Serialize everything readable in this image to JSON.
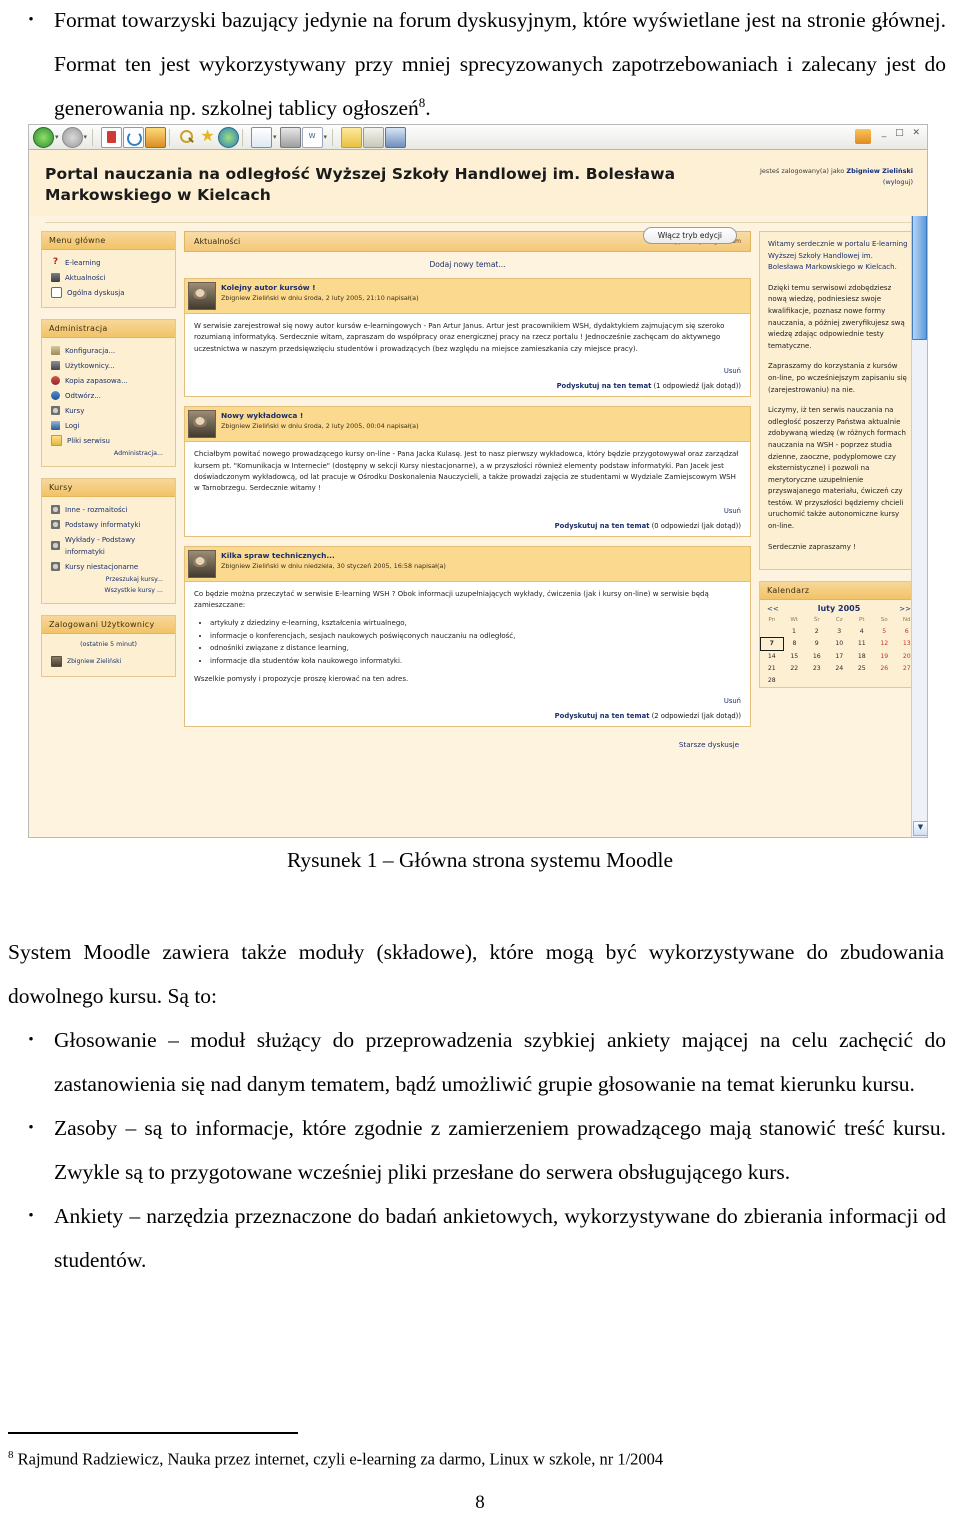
{
  "document": {
    "intro_bullets": [
      "Format towarzyski bazujący jedynie na forum dyskusyjnym, które wyświetlane jest na stronie głównej. Format ten jest wykorzystywany przy mniej sprecyzowanych zapotrzebowaniach i zalecany jest do generowania np. szkolnej tablicy ogłoszeń"
    ],
    "intro_footnote_marker": "8",
    "intro_trailing": ".",
    "figure_caption": "Rysunek 1 – Główna strona systemu Moodle",
    "after_paragraph": "System Moodle zawiera także moduły (składowe), które mogą być wykorzystywane do zbudowania dowolnego kursu. Są to:",
    "after_bullets": [
      "Głosowanie – moduł służący do przeprowadzenia szybkiej ankiety mającej na celu zachęcić do zastanowienia się nad danym tematem, bądź umożliwić grupie głosowanie na temat kierunku kursu.",
      "Zasoby – są to informacje, które zgodnie z zamierzeniem prowadzącego mają stanowić treść kursu. Zwykle są to przygotowane wcześniej pliki przesłane do serwera obsługującego kurs.",
      "Ankiety – narzędzia przeznaczone do badań ankietowych, wykorzystywane do zbierania informacji od studentów."
    ],
    "footnote_marker": "8",
    "footnote_text": "Rajmund Radziewicz, Nauka przez internet, czyli e-learning za darmo, Linux w szkole, nr 1/2004",
    "page_number": "8"
  },
  "screenshot": {
    "browser": {
      "window_buttons": "_ □ ✕",
      "toolbar_icons": [
        "back-arrow-icon",
        "forward-arrow-icon",
        "stop-icon",
        "refresh-icon",
        "home-icon",
        "search-icon",
        "favorites-star-icon",
        "history-icon",
        "mail-icon",
        "print-icon",
        "edit-word-icon",
        "notes-icon",
        "messenger-icon",
        "research-icon"
      ]
    },
    "header": {
      "site_title": "Portal nauczania na odległość Wyższej Szkoły Handlowej im. Bolesława Markowskiego w Kielcach",
      "login_prefix": "Jesteś zalogowany(a) jako ",
      "login_user": "Zbigniew Zieliński",
      "logout_label": "(wyloguj)"
    },
    "left_blocks": [
      {
        "title": "Menu główne",
        "items": [
          {
            "label": "E-learning",
            "icon": "question-mark-icon"
          },
          {
            "label": "Aktualności",
            "icon": "news-forum-icon"
          },
          {
            "label": "Ogólna dyskusja",
            "icon": "chat-bubble-icon"
          }
        ],
        "links": []
      },
      {
        "title": "Administracja",
        "items": [
          {
            "label": "Konfiguracja...",
            "icon": "config-tool-icon"
          },
          {
            "label": "Użytkownicy...",
            "icon": "users-icon"
          },
          {
            "label": "Kopia zapasowa...",
            "icon": "backup-icon"
          },
          {
            "label": "Odtwórz...",
            "icon": "restore-icon"
          },
          {
            "label": "Kursy",
            "icon": "courses-icon"
          },
          {
            "label": "Logi",
            "icon": "logs-icon"
          },
          {
            "label": "Pliki serwisu",
            "icon": "folder-icon"
          }
        ],
        "links": [
          "Administracja..."
        ]
      },
      {
        "title": "Kursy",
        "items": [
          {
            "label": "Inne - rozmaitości",
            "icon": "course-icon"
          },
          {
            "label": "Podstawy informatyki",
            "icon": "course-icon"
          },
          {
            "label": "Wykłady - Podstawy informatyki",
            "icon": "course-icon"
          },
          {
            "label": "Kursy niestacjonarne",
            "icon": "course-icon"
          }
        ],
        "links": [
          "Przeszukaj kursy...",
          "Wszystkie kursy ..."
        ]
      },
      {
        "title": "Zalogowani Użytkownicy",
        "subtitle": "(ostatnie 5 minut)",
        "items": [
          {
            "label": "Zbigniew Zieliński",
            "icon": "avatar-icon"
          }
        ],
        "links": []
      }
    ],
    "forum": {
      "section_title": "Aktualności",
      "unsubscribe_label": "Wypisz się z tego forum",
      "edit_mode_button": "Włącz tryb edycji",
      "add_topic_label": "Dodaj nowy temat...",
      "older_discussions_label": "Starsze dyskusje",
      "delete_label": "Usuń",
      "discuss_label": "Podyskutuj na ten temat",
      "posts": [
        {
          "title": "Kolejny autor kursów !",
          "meta": "Zbigniew Zieliński w dniu środa, 2 luty 2005, 21:10 napisał(a)",
          "paragraphs": [
            "W serwisie zarejestrował się nowy autor kursów e-learningowych - Pan Artur Janus. Artur jest pracownikiem WSH, dydaktykiem zajmującym się szeroko rozumianą informatyką. Serdecznie witam, zapraszam do współpracy oraz energicznej pracy na rzecz portalu ! Jednocześnie zachęcam do aktywnego uczestnictwa w naszym przedsięwzięciu studentów i prowadzących (bez względu na miejsce zamieszkania czy miejsce pracy)."
          ],
          "bullets": [],
          "tail": "",
          "replies": "(1 odpowiedź (jak dotąd))"
        },
        {
          "title": "Nowy wykładowca !",
          "meta": "Zbigniew Zieliński w dniu środa, 2 luty 2005, 00:04 napisał(a)",
          "paragraphs": [
            "Chciałbym powitać nowego prowadzącego kursy on-line - Pana Jacka Kulasę. Jest to nasz pierwszy wykładowca, który będzie przygotowywał oraz zarządzał kursem pt. \"Komunikacja w Internecie\" (dostępny w sekcji Kursy niestacjonarne), a w przyszłości również elementy podstaw informatyki. Pan Jacek jest doświadczonym wykładowcą, od lat pracuje w Ośrodku Doskonalenia Nauczycieli, a także prowadzi zajęcia ze studentami w Wydziale Zamiejscowym WSH w Tarnobrzegu. Serdecznie witamy !"
          ],
          "bullets": [],
          "tail": "",
          "replies": "(0 odpowiedzi (jak dotąd))"
        },
        {
          "title": "Kilka spraw technicznych...",
          "meta": "Zbigniew Zieliński w dniu niedziela, 30 styczeń 2005, 16:58 napisał(a)",
          "paragraphs": [
            "Co będzie można przeczytać w serwisie E-learning WSH ? Obok informacji uzupełniających wykłady, ćwiczenia (jak i kursy on-line) w serwisie będą zamieszczane:"
          ],
          "bullets": [
            "artykuły z dziedziny e-learning, kształcenia wirtualnego,",
            "informacje o konferencjach, sesjach naukowych poświęconych nauczaniu na odległość,",
            "odnośniki związane z distance learning,",
            "informacje dla studentów koła naukowego informatyki."
          ],
          "tail": "Wszelkie pomysły i propozycje proszę kierować na ten adres.",
          "tail_link": "ten adres",
          "replies": "(2 odpowiedzi (jak dotąd))"
        }
      ]
    },
    "right_column": {
      "welcome_paragraphs": [
        "Witamy serdecznie w portalu E-learning Wyższej Szkoły Handlowej im. Bolesława Markowskiego w Kielcach.",
        "Dzięki temu serwisowi zdobędziesz nową wiedzę, podniesiesz swoje kwalifikacje, poznasz nowe formy nauczania, a później zweryfikujesz swą wiedzę zdając odpowiednie testy tematyczne.",
        "Zapraszamy do korzystania z kursów on-line, po wcześniejszym zapisaniu się (zarejestrowaniu) na nie.",
        "Liczymy, iż ten serwis nauczania na odległość poszerzy Państwa aktualnie zdobywaną wiedzę (w różnych formach nauczania na WSH - poprzez studia dzienne, zaoczne, podyplomowe czy eksternistyczne) i pozwoli na merytoryczne uzupełnienie przyswajanego materiału, ćwiczeń czy testów. W przyszłości będziemy chcieli uruchomić także autonomiczne kursy on-line.",
        "Serdecznie zapraszamy !"
      ],
      "calendar": {
        "title": "Kalendarz",
        "prev": "<<",
        "next": ">>",
        "month": "luty 2005",
        "weekdays": [
          "Pn",
          "Wt",
          "Śr",
          "Cz",
          "Pt",
          "So",
          "Nd"
        ],
        "weeks": [
          [
            "",
            "1",
            "2",
            "3",
            "4",
            "5",
            "6"
          ],
          [
            "7",
            "8",
            "9",
            "10",
            "11",
            "12",
            "13"
          ],
          [
            "14",
            "15",
            "16",
            "17",
            "18",
            "19",
            "20"
          ],
          [
            "21",
            "22",
            "23",
            "24",
            "25",
            "26",
            "27"
          ],
          [
            "28",
            "",
            "",
            "",
            "",
            "",
            ""
          ]
        ],
        "today": "7",
        "weekend_columns": [
          5,
          6
        ]
      }
    },
    "colors": {
      "page_background": "#fdf3df",
      "block_background": "#fdf0d2",
      "block_header": "#f2c368",
      "post_header": "#fbd98e",
      "link": "#1a2f6b",
      "weekend": "#c2342a"
    }
  }
}
